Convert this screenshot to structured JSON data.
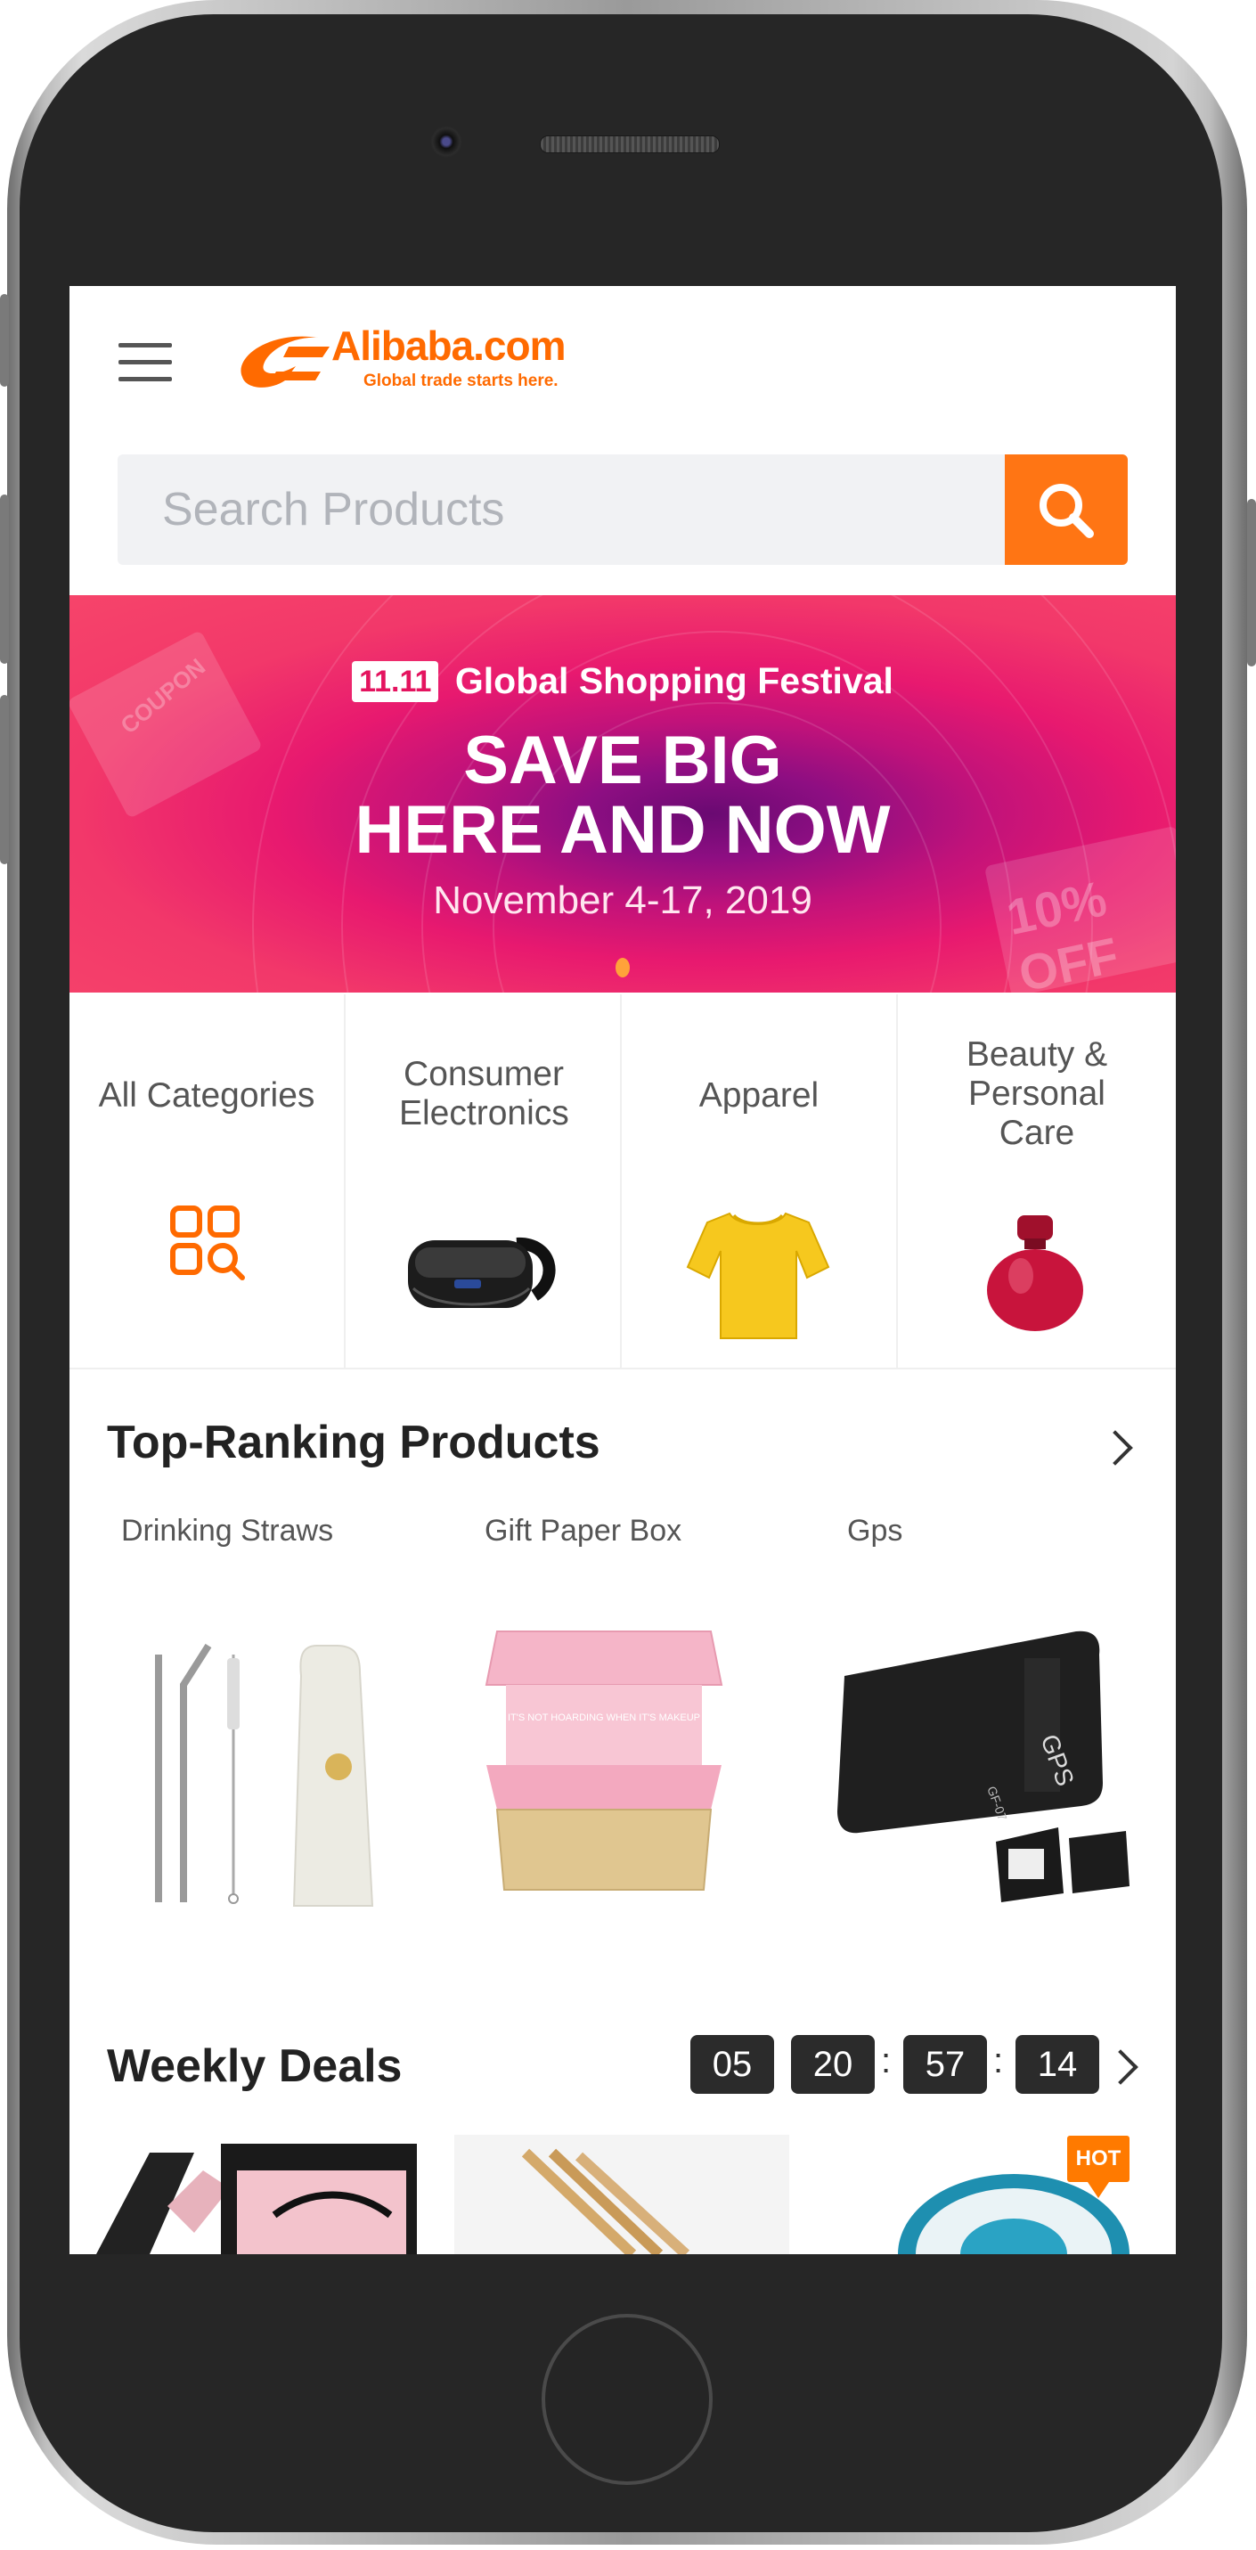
{
  "header": {
    "logo_text": "Alibaba.com",
    "tagline": "Global trade starts here."
  },
  "search": {
    "placeholder": "Search Products"
  },
  "banner": {
    "festival_logo": "11.11",
    "festival_name": "Global Shopping Festival",
    "headline_line1": "SAVE BIG",
    "headline_line2": "HERE AND NOW",
    "dates": "November 4-17, 2019",
    "deco_coupon": "COUPON",
    "deco_discount": "10% OFF"
  },
  "categories": [
    {
      "label": "All Categories",
      "icon": "grid-search-icon"
    },
    {
      "label": "Consumer Electronics",
      "icon": "vr-headset"
    },
    {
      "label": "Apparel",
      "icon": "yellow-tshirt"
    },
    {
      "label": "Beauty & Personal Care",
      "icon": "perfume-bottle"
    }
  ],
  "top_ranking": {
    "title": "Top-Ranking Products",
    "items": [
      {
        "label": "Drinking Straws"
      },
      {
        "label": "Gift Paper Box",
        "image_text": "IT'S NOT HOARDING WHEN IT'S MAKEUP"
      },
      {
        "label": "Gps",
        "image_text": "GPS",
        "model_text": "GF-07"
      }
    ]
  },
  "weekly_deals": {
    "title": "Weekly Deals",
    "timer": {
      "days": "05",
      "hours": "20",
      "minutes": "57",
      "seconds": "14"
    },
    "separator": ":",
    "hot_label": "HOT"
  },
  "colors": {
    "brand_orange": "#ff6a00",
    "search_button": "#ff7514",
    "banner_pink": "#e8196f",
    "timer_bg": "#2b2b2b"
  }
}
